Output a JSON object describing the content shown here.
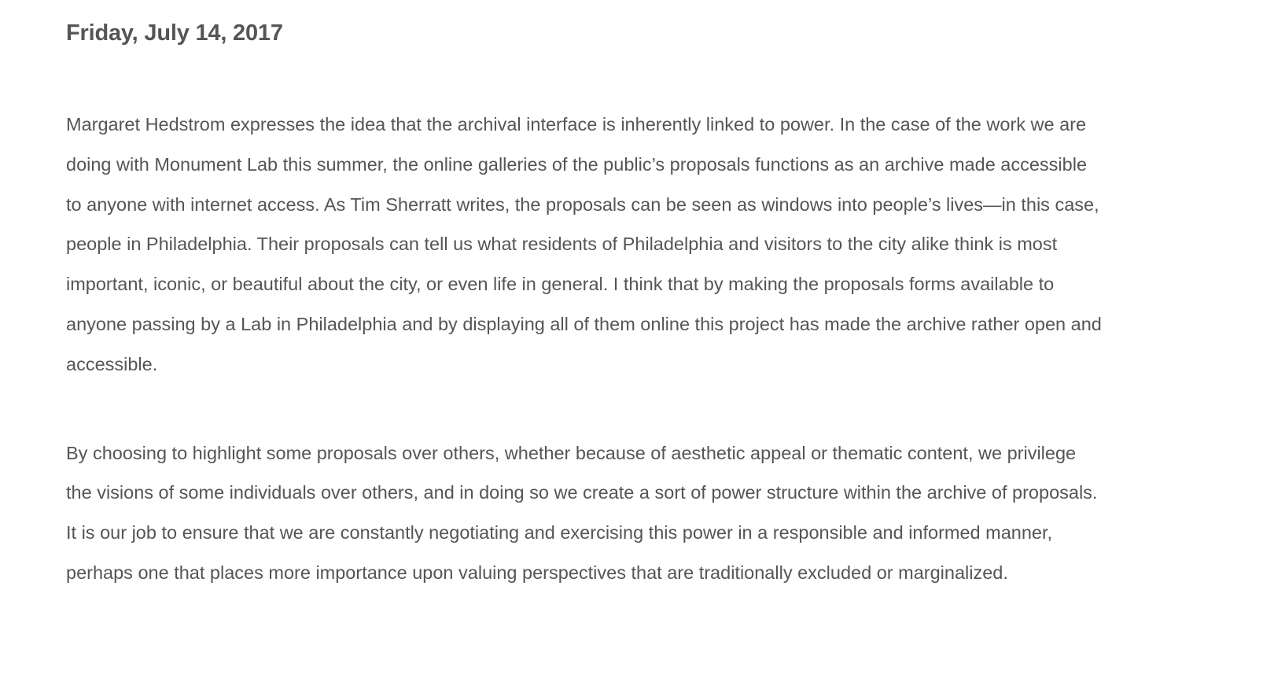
{
  "post": {
    "date": "Friday, July 14, 2017",
    "paragraphs": [
      "Margaret Hedstrom expresses the idea that the archival interface is inherently linked to power. In the case of the work we are doing with Monument Lab this summer, the online galleries of the public’s proposals functions as an archive made accessible to anyone with internet access. As Tim Sherratt writes, the proposals can be seen as windows into people’s lives—in this case, people in Philadelphia. Their proposals can tell us what residents of Philadelphia and visitors to the city alike think is most important, iconic, or beautiful about the city, or even life in general. I think that by making the proposals forms available to anyone passing by a Lab in Philadelphia and by displaying all of them online this project has made the archive rather open and accessible.",
      "By choosing to highlight some proposals over others, whether because of aesthetic appeal or thematic content, we privilege the visions of some individuals over others, and in doing so we create a sort of power structure within the archive of proposals. It is our job to ensure that we are constantly negotiating and exercising this power in a responsible and informed manner, perhaps one that places more importance upon valuing perspectives that are traditionally excluded or marginalized."
    ]
  },
  "colors": {
    "text": "#555555",
    "background": "#ffffff"
  }
}
